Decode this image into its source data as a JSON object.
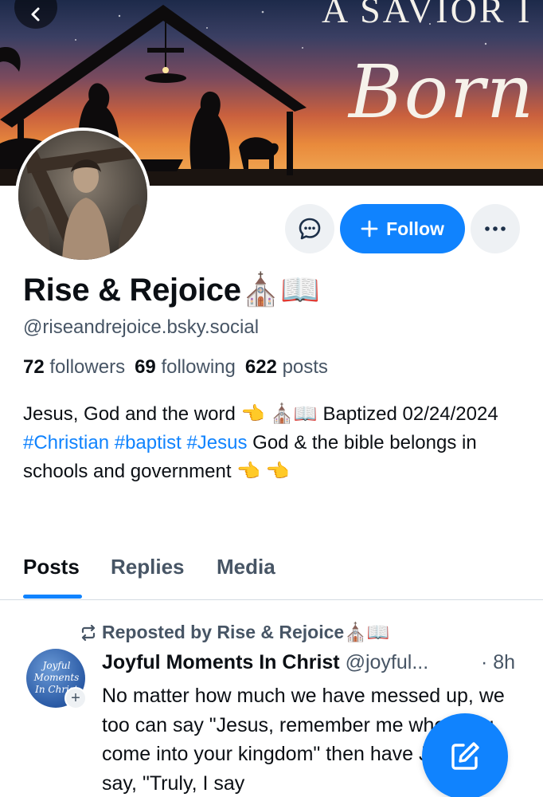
{
  "banner": {
    "text_top": "A SAVIOR I",
    "text_script": "Born"
  },
  "profile": {
    "display_name": "Rise & Rejoice⛪📖",
    "handle": "@riseandrejoice.bsky.social",
    "followers_count": "72",
    "followers_label": "followers",
    "following_count": "69",
    "following_label": "following",
    "posts_count": "622",
    "posts_label": "posts",
    "bio_part1": "Jesus, God and the word 👈 ⛪📖 Baptized 02/24/2024 ",
    "bio_tag1": "#Christian",
    "bio_tag2": "#baptist",
    "bio_tag3": "#Jesus",
    "bio_part2": " God & the bible belongs in schools and government 👈 👈"
  },
  "actions": {
    "follow_label": "Follow",
    "follow_icon": "plus-icon",
    "message_icon": "chat-bubble-icon",
    "more_icon": "ellipsis-icon"
  },
  "tabs": [
    {
      "label": "Posts",
      "active": true
    },
    {
      "label": "Replies",
      "active": false
    },
    {
      "label": "Media",
      "active": false
    }
  ],
  "post": {
    "repost_label": "Reposted by Rise & Rejoice⛪📖",
    "avatar_text": "Joyful Moments In Christ",
    "author_name": "Joyful Moments In Christ",
    "author_handle": "@joyful...",
    "time": "· 8h",
    "text": "No matter how much we have messed up, we too can say \"Jesus, remember me when you come into your kingdom\" then have Jesus say, \"Truly, I say"
  },
  "colors": {
    "accent": "#1083fe",
    "muted_text": "#475565",
    "button_bg": "#eef1f4"
  }
}
